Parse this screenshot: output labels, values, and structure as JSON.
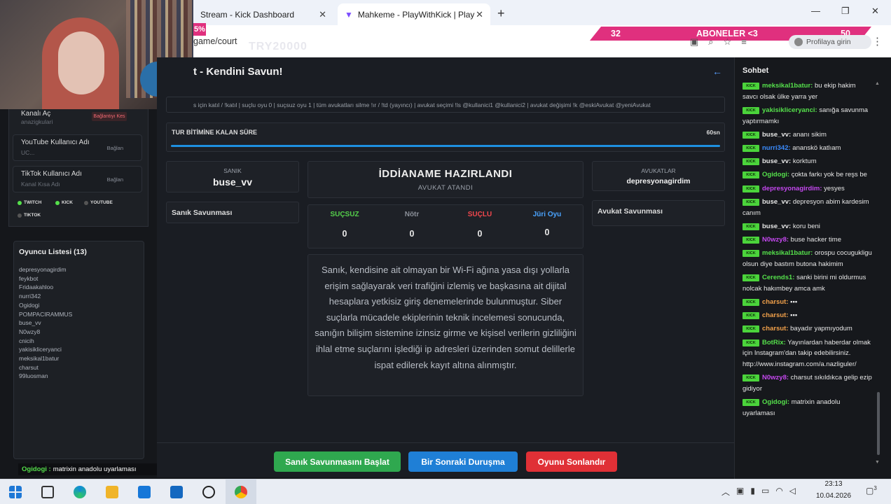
{
  "browser": {
    "tabs": [
      {
        "label": "Stream - Kick Dashboard",
        "close": "✕"
      },
      {
        "label": "Mahkeme - PlayWithKick | Play",
        "close": "✕"
      }
    ],
    "new_tab": "+",
    "url": "game/court",
    "window_controls": [
      "—",
      "❐",
      "✕"
    ],
    "signin": "Profilaya girin",
    "menu": "⋮"
  },
  "overlay": {
    "percent": "5%",
    "left": "32",
    "mid": "ABONELER <3",
    "right": "50",
    "try": "TRY20000"
  },
  "left_panel": {
    "row0_title": "Kanalı Aç",
    "row0_badge": "Bağlantıyı Kes",
    "row0_sub": "anazigkulari",
    "rows": [
      {
        "title": "YouTube Kullanıcı Adı",
        "sub": "UC...",
        "btn": "Bağlan"
      },
      {
        "title": "TikTok Kullanıcı Adı",
        "sub": "Kanal Kısa Adı",
        "btn": "Bağlan"
      }
    ],
    "platforms": [
      "TWITCH",
      "KICK",
      "YOUTUBE",
      "TIKTOK"
    ],
    "colors": {
      "twitch": "#55e04b",
      "kick": "#55e04b",
      "youtube": "#555",
      "tiktok": "#555"
    }
  },
  "players": {
    "title": "Oyuncu Listesi (13)",
    "list": [
      "depresyonagirdim",
      "feykbot",
      "Fridaakahloo",
      "nurri342",
      "Ogidogi",
      "POMPACIRAMMUS",
      "buse_vv",
      "N0wzy8",
      "cnicih",
      "yakisikliceryanci",
      "meksikal1batur",
      "charsut",
      "99luosman"
    ]
  },
  "ticker": {
    "name": "Ogidogi :",
    "text": "matrixin anadolu uyarlaması"
  },
  "game": {
    "title": "t - Kendini Savun!",
    "back": "←",
    "commands": "s için katıl / !katıl | suçlu oyu 0 | suçsuz oyu 1 | tüm avukatları silme !ır / !td (yayıncı) | avukat seçimi !ls @kullanici1 @kullanici2 | avukat değişimi !k @eskiAvukat @yeniAvukat",
    "timer_label": "TUR BİTİMİNE KALAN SÜRE",
    "timer_value": "60sn",
    "timer_progress": 1.0,
    "defendant_key": "SANIK",
    "defendant": "buse_vv",
    "defense_title": "Sanık Savunması",
    "lawyer_key": "AVUKATLAR",
    "lawyer": "depresyonagirdim",
    "lawyer_defense_title": "Avukat Savunması",
    "status_title": "İDDİANAME HAZIRLANDI",
    "status_sub": "AVUKAT ATANDI",
    "votes": [
      {
        "label": "SUÇSUZ",
        "count": "0",
        "color": "#55d04b"
      },
      {
        "label": "Nötr",
        "count": "0",
        "color": "#8b9099"
      },
      {
        "label": "SUÇLU",
        "count": "0",
        "color": "#f0474d"
      },
      {
        "label": "Jüri Oyu",
        "count": "0",
        "color": "#4aa4ff"
      }
    ],
    "case_text": "Sanık, kendisine ait olmayan bir Wi-Fi ağına yasa dışı yollarla erişim sağlayarak veri trafiğini izlemiş ve başkasına ait dijital hesaplara yetkisiz giriş denemelerinde bulunmuştur. Siber suçlarla mücadele ekiplerinin teknik incelemesi sonucunda, sanığın bilişim sistemine izinsiz girme ve kişisel verilerin gizliliğini ihlal etme suçlarını işlediği ip adresleri üzerinden somut delillerle ispat edilerek kayıt altına alınmıştır.",
    "buttons": {
      "start": "Sanık Savunmasını Başlat",
      "next": "Bir Sonraki Duruşma",
      "end": "Oyunu Sonlandır"
    }
  },
  "chat": {
    "title": "Sohbet",
    "badge": "KICK",
    "messages": [
      {
        "user": "meksikal1batur:",
        "color": "#55e04b",
        "text": "bu ekip hakim savcı olsak ülke yarra yer"
      },
      {
        "user": "yakisikliceryanci:",
        "color": "#55e04b",
        "text": "sanığa savunma yaptırmamkı"
      },
      {
        "user": "buse_vv:",
        "color": "#e6e6e6",
        "text": "ananı sikim"
      },
      {
        "user": "nurri342:",
        "color": "#3b8cff",
        "text": "ananskö katlıam"
      },
      {
        "user": "buse_vv:",
        "color": "#e6e6e6",
        "text": "korktum"
      },
      {
        "user": "Ogidogi:",
        "color": "#55e04b",
        "text": "çokta farkı yok be reşs be"
      },
      {
        "user": "depresyonagirdim:",
        "color": "#c548f0",
        "text": "yesyes"
      },
      {
        "user": "buse_vv:",
        "color": "#e6e6e6",
        "text": "depresyon abim kardesim canım"
      },
      {
        "user": "buse_vv:",
        "color": "#e6e6e6",
        "text": "koru beni"
      },
      {
        "user": "N0wzy8:",
        "color": "#c548f0",
        "text": "buse hacker time"
      },
      {
        "user": "meksikal1batur:",
        "color": "#55e04b",
        "text": "orospu cocugukligu olsun diye bastım butona hakimim"
      },
      {
        "user": "Cerends1:",
        "color": "#55e04b",
        "text": "sanki birini mi oldurmus nolcak hakımbey amca amk"
      },
      {
        "user": "charsut:",
        "color": "#f2a14a",
        "text": "▪▪▪"
      },
      {
        "user": "charsut:",
        "color": "#f2a14a",
        "text": "▪▪▪"
      },
      {
        "user": "charsut:",
        "color": "#f2a14a",
        "text": "bayadır yapmıyodum"
      },
      {
        "user": "BotRix:",
        "color": "#55e04b",
        "text": "Yayınlardan haberdar olmak için Instagram'dan takip edebilirsiniz. http://www.instagram.com/a.nazliguler/"
      },
      {
        "user": "N0wzy8:",
        "color": "#c548f0",
        "text": "charsut sıkıldıkca gelip ezip gidiyor"
      },
      {
        "user": "Ogidogi:",
        "color": "#55e04b",
        "text": "matrixin anadolu uyarlaması"
      }
    ]
  },
  "taskbar": {
    "time": "23:13",
    "date": "10.04.2026",
    "notif": "3"
  }
}
